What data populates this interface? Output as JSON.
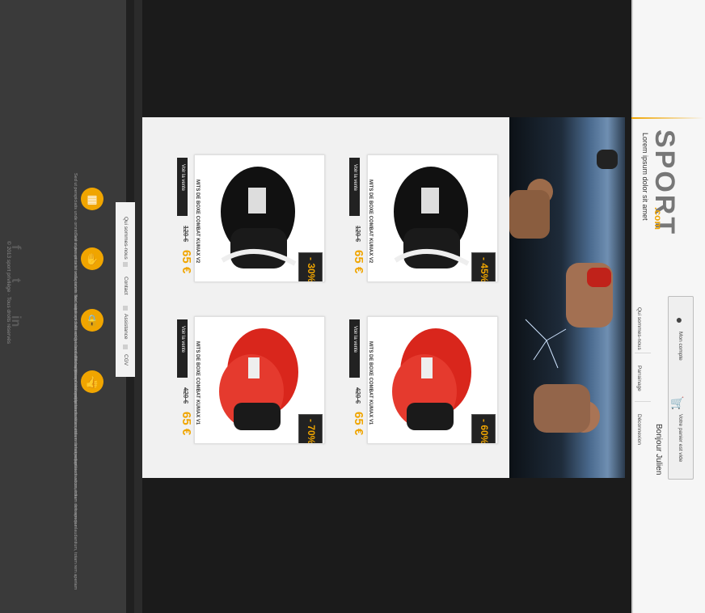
{
  "brand": {
    "logo_main": "SPORT",
    "logo_sub": ".com",
    "tagline": "Lorem ipsum dolor sit amet",
    "accent_color": "#f0a500"
  },
  "header": {
    "account_label": "Mon compte",
    "cart_label": "Votre panier est vide",
    "greeting": "Bonjour Julien",
    "nav": [
      "Qui sommes-nous",
      "Parrainage",
      "Déconnexion"
    ]
  },
  "products": [
    {
      "name": "MITS DE BOXE COMBAT KUMAX V2",
      "old_price": "120 €",
      "new_price": "65 €",
      "discount": "- 45%",
      "cta": "Voir la vente",
      "color": "black"
    },
    {
      "name": "MITS DE BOXE COMBAT KUMAX V2",
      "old_price": "120 €",
      "new_price": "65 €",
      "discount": "- 30%",
      "cta": "Voir la vente",
      "color": "black"
    },
    {
      "name": "MITS DE BOXE COMBAT KUMAX V1",
      "old_price": "420 €",
      "new_price": "65 €",
      "discount": "- 60%",
      "cta": "Voir la vente",
      "color": "red"
    },
    {
      "name": "MITS DE BOXE COMBAT KUMAX V1",
      "old_price": "420 €",
      "new_price": "65 €",
      "discount": "- 70%",
      "cta": "Voir la vente",
      "color": "red"
    }
  ],
  "footer_nav": [
    "Qui sommes-nous",
    "Contact",
    "Assistance",
    "CGV"
  ],
  "features": [
    {
      "icon": "card-icon",
      "text": "Sed ut perspiciatis unde omnis iste natus error sit voluptatem accusantium doloremque laudantium, totam rem aperiam"
    },
    {
      "icon": "thumb-down-icon",
      "text": "Sed ut perspiciatis unde omnis iste natus error sit voluptatem accusantium doloremque laudantium, totam rem aperiam"
    },
    {
      "icon": "lock-icon",
      "text": "Sed ut perspiciatis unde omnis iste natus error sit voluptatem accusantium doloremque laudantium, totam rem aperiam"
    },
    {
      "icon": "thumb-up-icon",
      "text": "Sed ut perspiciatis unde omnis iste natus error sit voluptatem accusantium doloremque laudantium, totam rem aperiam"
    }
  ],
  "social": [
    "f",
    "t",
    "in"
  ],
  "copyright": "© 2013 sport privilège · Tous droits réservés"
}
